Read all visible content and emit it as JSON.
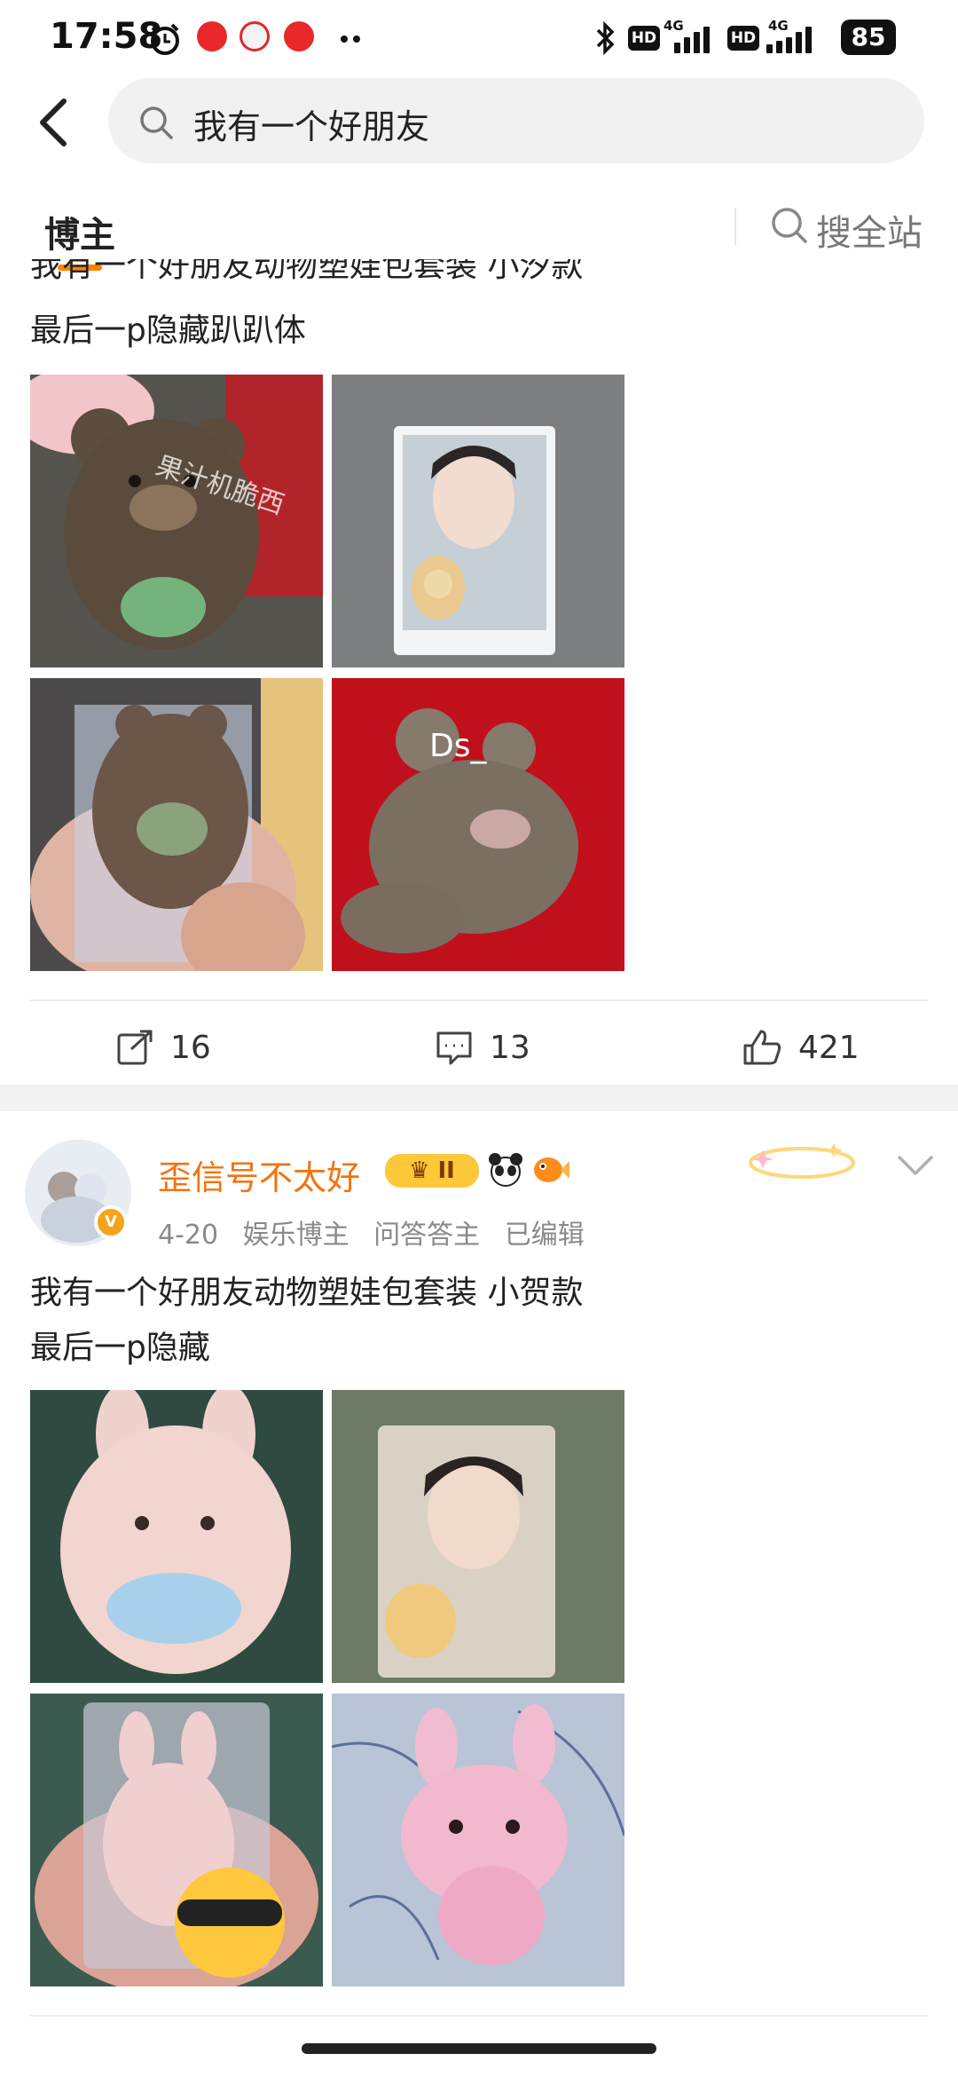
{
  "status": {
    "time": "17:58",
    "battery": "85",
    "hd1": "HD",
    "hd2": "HD",
    "net1": "4G",
    "net2": "4G"
  },
  "search": {
    "query": "我有一个好朋友"
  },
  "tabs": {
    "active": "博主",
    "search_all": "搜全站"
  },
  "post1": {
    "cut_text": "我有一个好朋友动物塑娃包套装 小汐款",
    "text_line2": "最后一p隐藏趴趴体",
    "photo_watermark1": "果汁机脆西",
    "photo_watermark4": "Ds_",
    "actions": {
      "repost_count": "16",
      "comment_count": "13",
      "like_count": "421"
    }
  },
  "post2": {
    "username": "歪信号不太好",
    "level_badge": "II",
    "vip_mark": "V",
    "date": "4-20",
    "tags": [
      "娱乐博主",
      "问答答主",
      "已编辑"
    ],
    "text_line1": "我有一个好朋友动物塑娃包套装 小贺款",
    "text_line2": "最后一p隐藏"
  },
  "colors": {
    "accent": "#ff8200",
    "username": "#f2740f",
    "meta": "#8a8a8a"
  }
}
